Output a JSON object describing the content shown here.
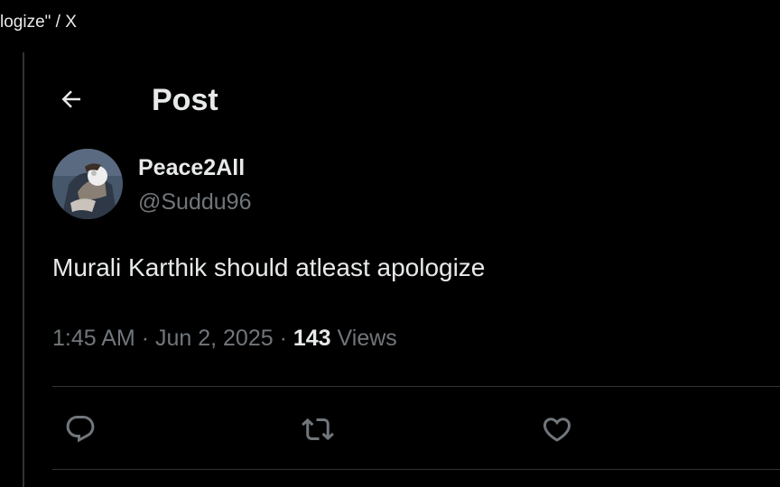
{
  "window": {
    "title": "logize\" / X"
  },
  "header": {
    "back_icon": "arrow-left-icon",
    "title": "Post"
  },
  "author": {
    "display_name": "Peace2All",
    "handle": "@Suddu96"
  },
  "tweet": {
    "text": "Murali Karthik should atleast apologize",
    "time": "1:45 AM",
    "separator": "·",
    "date": "Jun 2, 2025",
    "views_count": "143",
    "views_label": "Views"
  },
  "actions": [
    {
      "name": "reply",
      "icon": "comment-bubble-icon"
    },
    {
      "name": "repost",
      "icon": "repost-arrows-icon"
    },
    {
      "name": "like",
      "icon": "heart-icon"
    }
  ],
  "colors": {
    "background": "#000000",
    "primary_text": "#e7e9ea",
    "secondary_text": "#71767b",
    "border": "#2f3336"
  }
}
